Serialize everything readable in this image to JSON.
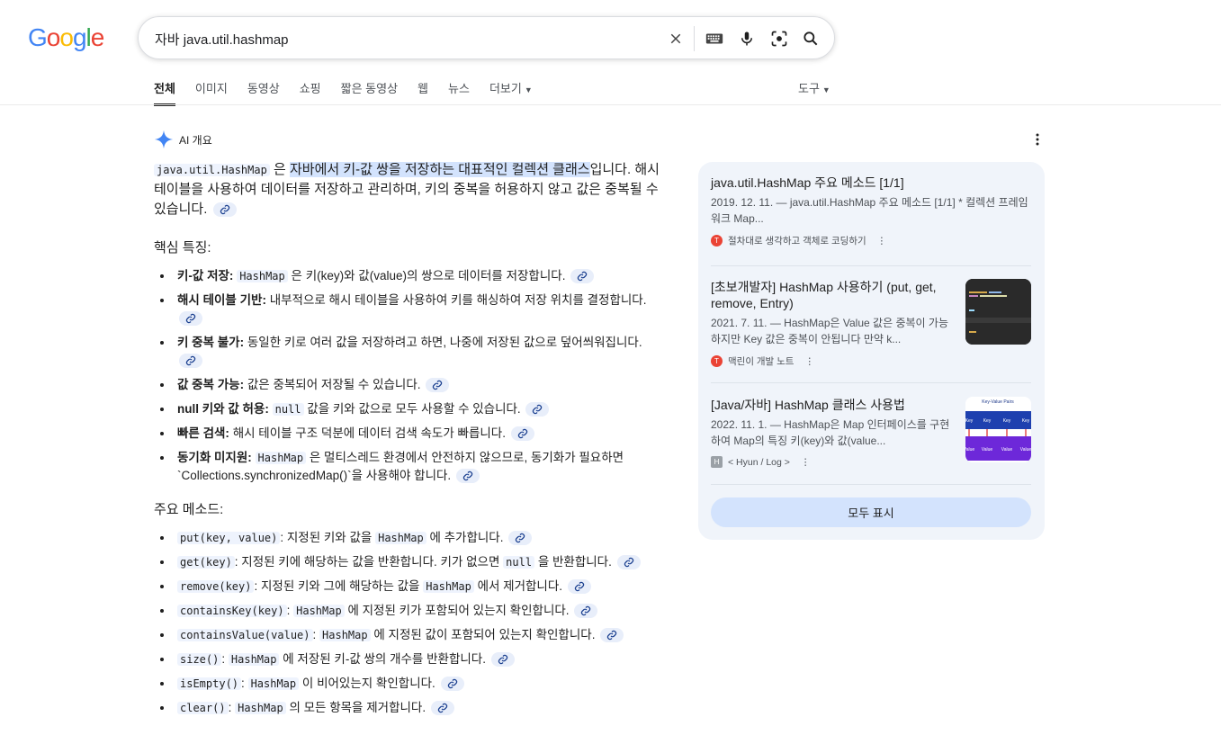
{
  "search": {
    "query": "자바 java.util.hashmap",
    "icons": [
      "close-icon",
      "keyboard-icon",
      "mic-icon",
      "lens-icon",
      "search-icon"
    ]
  },
  "logo": {
    "l1": "G",
    "l2": "o",
    "l3": "o",
    "l4": "g",
    "l5": "l",
    "l6": "e"
  },
  "tabs": [
    {
      "label": "전체"
    },
    {
      "label": "이미지"
    },
    {
      "label": "동영상"
    },
    {
      "label": "쇼핑"
    },
    {
      "label": "짧은 동영상"
    },
    {
      "label": "웹"
    },
    {
      "label": "뉴스"
    },
    {
      "label": "더보기"
    }
  ],
  "tools_label": "도구",
  "ai": {
    "header": "AI 개요",
    "intro_code": "java.util.HashMap",
    "intro_mid": "은 ",
    "intro_highlight": "자바에서 키-값 쌍을 저장하는 대표적인 컬렉션 클래스",
    "intro_rest": "입니다. 해시 테이블을 사용하여 데이터를 저장하고 관리하며, 키의 중복을 허용하지 않고 값은 중복될 수 있습니다.",
    "features_title": "핵심 특징:",
    "features": [
      {
        "bold": "키-값 저장:",
        "code": "HashMap",
        "text": "은 키(key)와 값(value)의 쌍으로 데이터를 저장합니다."
      },
      {
        "bold": "해시 테이블 기반:",
        "text": "내부적으로 해시 테이블을 사용하여 키를 해싱하여 저장 위치를 결정합니다."
      },
      {
        "bold": "키 중복 불가:",
        "text": "동일한 키로 여러 값을 저장하려고 하면, 나중에 저장된 값으로 덮어씌워집니다."
      },
      {
        "bold": "값 중복 가능:",
        "text": "값은 중복되어 저장될 수 있습니다."
      },
      {
        "bold": "null 키와 값 허용:",
        "code": "null",
        "text": "값을 키와 값으로 모두 사용할 수 있습니다."
      },
      {
        "bold": "빠른 검색:",
        "text": "해시 테이블 구조 덕분에 데이터 검색 속도가 빠릅니다."
      },
      {
        "bold": "동기화 미지원:",
        "code": "HashMap",
        "text": "은 멀티스레드 환경에서 안전하지 않으므로, 동기화가 필요하면 `Collections.synchronizedMap()`을 사용해야 합니다."
      }
    ],
    "methods_title": "주요 메소드:",
    "methods": [
      {
        "code": "put(key, value)",
        "text": ": 지정된 키와 값을",
        "code2": "HashMap",
        "text2": "에 추가합니다."
      },
      {
        "code": "get(key)",
        "text": ": 지정된 키에 해당하는 값을 반환합니다. 키가 없으면",
        "code2": "null",
        "text2": "을 반환합니다."
      },
      {
        "code": "remove(key)",
        "text": ": 지정된 키와 그에 해당하는 값을",
        "code2": "HashMap",
        "text2": "에서 제거합니다."
      },
      {
        "code": "containsKey(key)",
        "text": ":",
        "code2": "HashMap",
        "text2": "에 지정된 키가 포함되어 있는지 확인합니다."
      },
      {
        "code": "containsValue(value)",
        "text": ":",
        "code2": "HashMap",
        "text2": "에 지정된 값이 포함되어 있는지 확인합니다."
      },
      {
        "code": "size()",
        "text": ":",
        "code2": "HashMap",
        "text2": "에 저장된 키-값 쌍의 개수를 반환합니다."
      },
      {
        "code": "isEmpty()",
        "text": ":",
        "code2": "HashMap",
        "text2": "이 비어있는지 확인합니다."
      },
      {
        "code": "clear()",
        "text": ":",
        "code2": "HashMap",
        "text2": "의 모든 항목을 제거합니다."
      }
    ]
  },
  "sources": [
    {
      "title": "java.util.HashMap 주요 메소드 [1/1]",
      "snippet": "2019. 12. 11. — java.util.HashMap 주요 메소드 [1/1] * 컬렉션 프레임워크 Map...",
      "site": "절차대로 생각하고 객체로 코딩하기",
      "fav_color": "#ea4335"
    },
    {
      "title": "[초보개발자] HashMap 사용하기 (put, get, remove, Entry)",
      "snippet": "2021. 7. 11. — HashMap은 Value 값은 중복이 가능하지만 Key 값은 중복이 안됩니다 만약 k...",
      "site": "맥린이 개발 노트",
      "fav_color": "#ea4335"
    },
    {
      "title": "[Java/자바] HashMap 클래스 사용법",
      "snippet": "2022. 11. 1. — HashMap은 Map 인터페이스를 구현하여 Map의 특징 키(key)와 값(value...",
      "site": "< Hyun / Log >",
      "fav_color": "#9aa0a6",
      "thumb_title": "Key-Value Pairs",
      "thumb_key": "Key",
      "thumb_value": "Value"
    }
  ],
  "show_all": "모두 표시"
}
